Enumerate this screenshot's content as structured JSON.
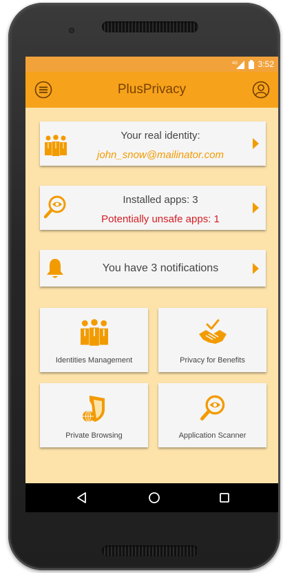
{
  "status": {
    "network": "4G",
    "time": "3:52"
  },
  "appbar": {
    "title": "PlusPrivacy",
    "menu_icon": "menu-icon",
    "profile_icon": "account-icon"
  },
  "identity_card": {
    "title": "Your real identity:",
    "email": "john_snow@mailinator.com"
  },
  "apps_card": {
    "installed": "Installed apps: 3",
    "unsafe": "Potentially unsafe apps: 1"
  },
  "notifications_card": {
    "text": "You have 3 notifications"
  },
  "tiles": [
    {
      "label": "Identities Management",
      "icon": "people-icon"
    },
    {
      "label": "Privacy for Benefits",
      "icon": "handshake-icon"
    },
    {
      "label": "Private Browsing",
      "icon": "shield-globe-icon"
    },
    {
      "label": "Application Scanner",
      "icon": "magnifier-eye-icon"
    }
  ],
  "navbar": {
    "back": "back-icon",
    "home": "home-icon",
    "recents": "recents-icon"
  },
  "colors": {
    "primary": "#f7a21b",
    "accent": "#f29b00",
    "background": "#fde3aa",
    "warning": "#d32027"
  }
}
